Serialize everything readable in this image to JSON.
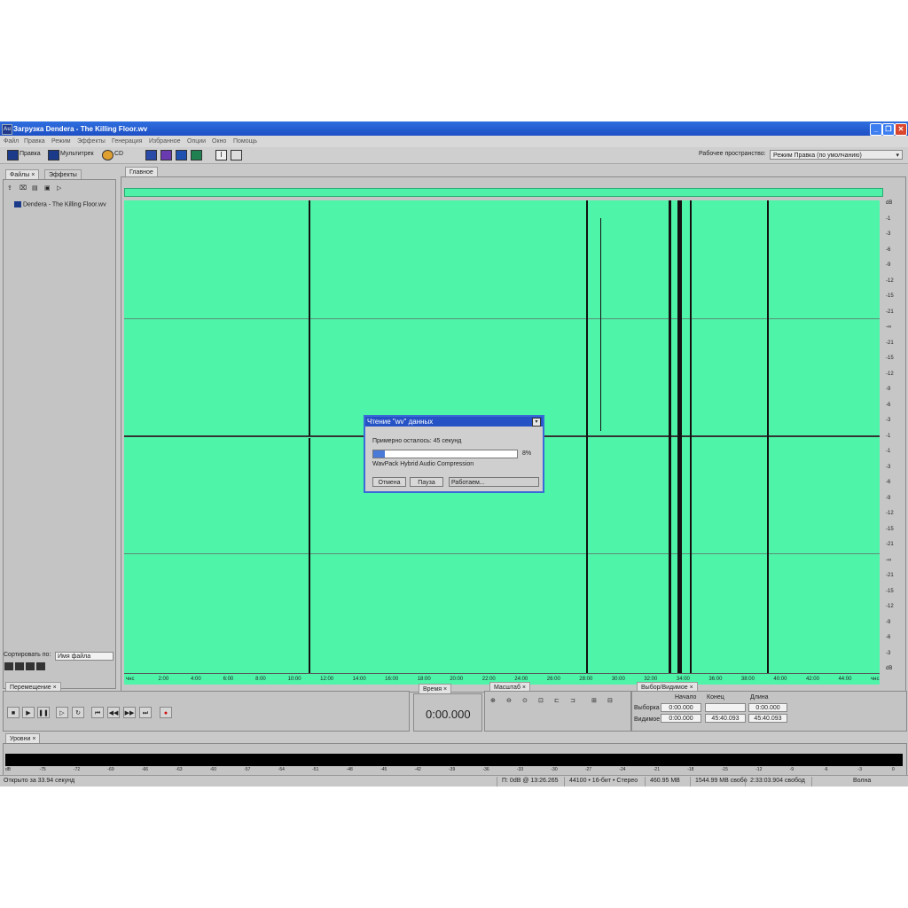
{
  "window": {
    "app_badge": "Au",
    "title": "Загрузка Dendera - The Killing Floor.wv"
  },
  "menu": [
    "Файл",
    "Правка",
    "Режим",
    "Эффекты",
    "Генерация",
    "Избранное",
    "Опции",
    "Окно",
    "Помощь"
  ],
  "toolbar": {
    "edit_label": "Правка",
    "multitrack_label": "Мультитрек",
    "cd_label": "CD",
    "workspace_label": "Рабочее пространство:",
    "workspace_value": "Режим Правка (по умолчанию)"
  },
  "files_panel": {
    "tabs": [
      "Файлы",
      "Эффекты"
    ],
    "items": [
      "Dendera - The Killing Floor.wv"
    ],
    "sort_label": "Сортировать по:",
    "sort_value": "Имя файла"
  },
  "editor": {
    "tab": "Главное",
    "timeline": [
      "чнс",
      "2:00",
      "4:00",
      "6:00",
      "8:00",
      "10:00",
      "12:00",
      "14:00",
      "16:00",
      "18:00",
      "20:00",
      "22:00",
      "24:00",
      "26:00",
      "28:00",
      "30:00",
      "32:00",
      "34:00",
      "36:00",
      "38:00",
      "40:00",
      "42:00",
      "44:00",
      "чнс"
    ],
    "db_scale": [
      "dB",
      "-1",
      "-3",
      "-6",
      "-9",
      "-12",
      "-15",
      "-21",
      "-∞",
      "-21",
      "-15",
      "-12",
      "-9",
      "-6",
      "-3",
      "-1",
      "-1",
      "-3",
      "-6",
      "-9",
      "-12",
      "-15",
      "-21",
      "-∞",
      "-21",
      "-15",
      "-12",
      "-9",
      "-6",
      "-3",
      "dB"
    ]
  },
  "dialog": {
    "title": "Чтение \"wv\" данных",
    "remaining": "Примерно осталось: 45 секунд",
    "progress": 8,
    "percent_label": "8%",
    "codec": "WavPack Hybrid Audio Compression",
    "cancel": "Отмена",
    "pause": "Пауза",
    "status": "Работаем..."
  },
  "transport": {
    "tab": "Перемещение"
  },
  "time_panel": {
    "tab": "Время",
    "value": "0:00.000"
  },
  "zoom_panel": {
    "tab": "Масштаб"
  },
  "selection_panel": {
    "tab": "Выбор/Видимое",
    "headers": [
      "Начало",
      "Конец",
      "Длина"
    ],
    "rows": [
      {
        "label": "Выборка",
        "start": "0:00.000",
        "end": "",
        "length": "0:00.000"
      },
      {
        "label": "Видимое",
        "start": "0:00.000",
        "end": "45:40.093",
        "length": "45:40.093"
      }
    ]
  },
  "levels": {
    "tab": "Уровни",
    "ticks": [
      "dB",
      "-75",
      "-72",
      "-69",
      "-66",
      "-63",
      "-60",
      "-57",
      "-54",
      "-51",
      "-48",
      "-45",
      "-42",
      "-39",
      "-36",
      "-33",
      "-30",
      "-27",
      "-24",
      "-21",
      "-18",
      "-15",
      "-12",
      "-9",
      "-6",
      "-3",
      "0"
    ]
  },
  "status": {
    "opened": "Открыто за 33.94 секунд",
    "peak": "П: 0dB @ 13:26.265",
    "format": "44100 • 16-бит • Стерео",
    "size": "460.95 MB",
    "free": "1544.99 MB свобо",
    "free_time": "2:33:03.904 свобод",
    "view": "Волна"
  }
}
